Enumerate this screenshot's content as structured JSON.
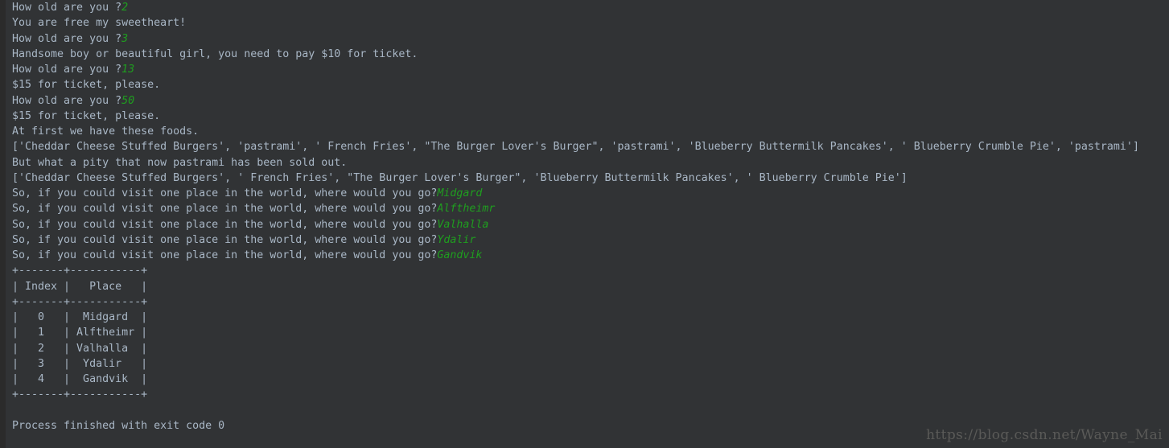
{
  "console": {
    "background_color": "#313335",
    "text_color": "#a9b7c6",
    "input_color": "#1f9e1f",
    "gutter_color": "#2b2b2b",
    "lines": [
      {
        "type": "prompt",
        "text": "How old are you ?",
        "input": "2"
      },
      {
        "type": "text",
        "text": "You are free my sweetheart!"
      },
      {
        "type": "prompt",
        "text": "How old are you ?",
        "input": "3"
      },
      {
        "type": "text",
        "text": "Handsome boy or beautiful girl, you need to pay $10 for ticket."
      },
      {
        "type": "prompt",
        "text": "How old are you ?",
        "input": "13"
      },
      {
        "type": "text",
        "text": "$15 for ticket, please."
      },
      {
        "type": "prompt",
        "text": "How old are you ?",
        "input": "50"
      },
      {
        "type": "text",
        "text": "$15 for ticket, please."
      },
      {
        "type": "text",
        "text": "At first we have these foods."
      },
      {
        "type": "text",
        "text": "['Cheddar Cheese Stuffed Burgers', 'pastrami', ' French Fries', \"The Burger Lover's Burger\", 'pastrami', 'Blueberry Buttermilk Pancakes', ' Blueberry Crumble Pie', 'pastrami']"
      },
      {
        "type": "text",
        "text": "But what a pity that now pastrami has been sold out."
      },
      {
        "type": "text",
        "text": "['Cheddar Cheese Stuffed Burgers', ' French Fries', \"The Burger Lover's Burger\", 'Blueberry Buttermilk Pancakes', ' Blueberry Crumble Pie']"
      },
      {
        "type": "prompt",
        "text": "So, if you could visit one place in the world, where would you go?",
        "input": "Midgard"
      },
      {
        "type": "prompt",
        "text": "So, if you could visit one place in the world, where would you go?",
        "input": "Alftheimr"
      },
      {
        "type": "prompt",
        "text": "So, if you could visit one place in the world, where would you go?",
        "input": "Valhalla"
      },
      {
        "type": "prompt",
        "text": "So, if you could visit one place in the world, where would you go?",
        "input": "Ydalir"
      },
      {
        "type": "prompt",
        "text": "So, if you could visit one place in the world, where would you go?",
        "input": "Gandvik"
      },
      {
        "type": "text",
        "text": "+-------+-----------+"
      },
      {
        "type": "text",
        "text": "| Index |   Place   |"
      },
      {
        "type": "text",
        "text": "+-------+-----------+"
      },
      {
        "type": "text",
        "text": "|   0   |  Midgard  |"
      },
      {
        "type": "text",
        "text": "|   1   | Alftheimr |"
      },
      {
        "type": "text",
        "text": "|   2   | Valhalla  |"
      },
      {
        "type": "text",
        "text": "|   3   |  Ydalir   |"
      },
      {
        "type": "text",
        "text": "|   4   |  Gandvik  |"
      },
      {
        "type": "text",
        "text": "+-------+-----------+"
      },
      {
        "type": "blank",
        "text": ""
      },
      {
        "type": "text",
        "text": "Process finished with exit code 0"
      }
    ],
    "table": {
      "columns": [
        "Index",
        "Place"
      ],
      "rows": [
        [
          "0",
          "Midgard"
        ],
        [
          "1",
          "Alftheimr"
        ],
        [
          "2",
          "Valhalla"
        ],
        [
          "3",
          "Ydalir"
        ],
        [
          "4",
          "Gandvik"
        ]
      ]
    },
    "exit_status": "Process finished with exit code 0"
  },
  "watermark": {
    "text": "https://blog.csdn.net/Wayne_Mai"
  }
}
